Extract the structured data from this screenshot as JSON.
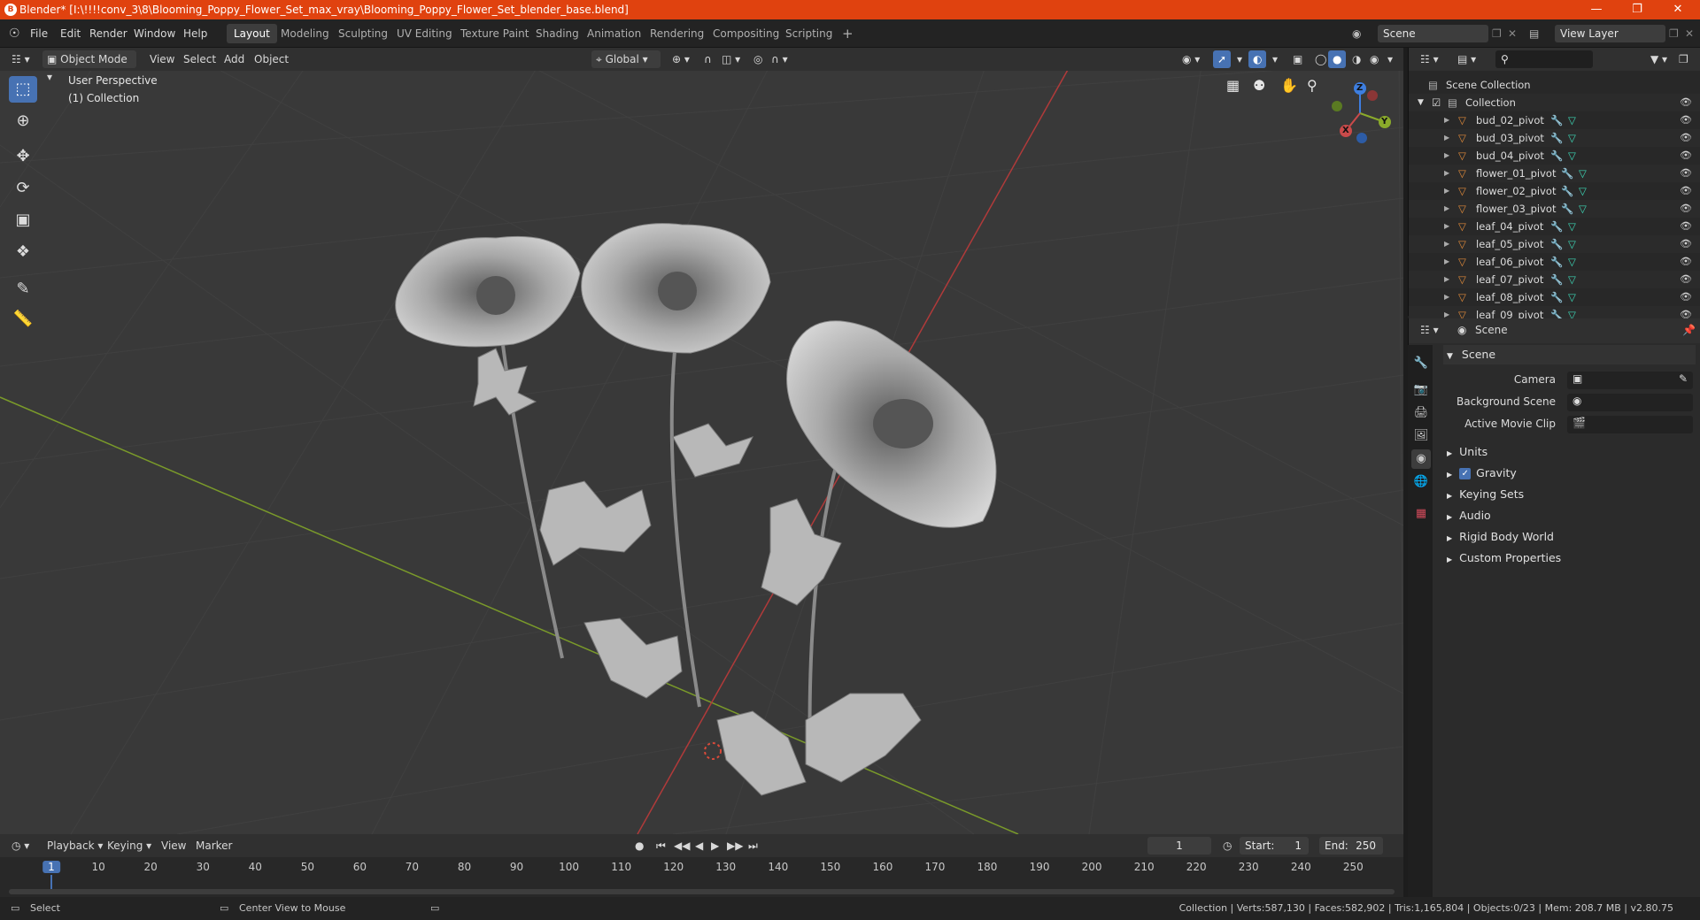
{
  "title_bar": {
    "title": "Blender* [I:\\!!!!conv_3\\8\\Blooming_Poppy_Flower_Set_max_vray\\Blooming_Poppy_Flower_Set_blender_base.blend]"
  },
  "menu": {
    "items": [
      "File",
      "Edit",
      "Render",
      "Window",
      "Help"
    ]
  },
  "workspaces": {
    "tabs": [
      "Layout",
      "Modeling",
      "Sculpting",
      "UV Editing",
      "Texture Paint",
      "Shading",
      "Animation",
      "Rendering",
      "Compositing",
      "Scripting"
    ],
    "add": "+"
  },
  "scene_selector": {
    "value": "Scene"
  },
  "view_layer_selector": {
    "value": "View Layer"
  },
  "viewport_header": {
    "mode": "Object Mode",
    "menus": [
      "View",
      "Select",
      "Add",
      "Object"
    ],
    "transform_orientation": "Global"
  },
  "viewport": {
    "perspective": "User Perspective",
    "collection": "(1) Collection"
  },
  "gizmo": {
    "x": "X",
    "y": "Y",
    "z": "Z"
  },
  "outliner": {
    "search_placeholder": "",
    "root": "Scene Collection",
    "collection": "Collection",
    "items": [
      "bud_02_pivot",
      "bud_03_pivot",
      "bud_04_pivot",
      "flower_01_pivot",
      "flower_02_pivot",
      "flower_03_pivot",
      "leaf_04_pivot",
      "leaf_05_pivot",
      "leaf_06_pivot",
      "leaf_07_pivot",
      "leaf_08_pivot",
      "leaf_09_pivot"
    ]
  },
  "properties": {
    "header": "Scene",
    "section": "Scene",
    "camera_label": "Camera",
    "background_scene_label": "Background Scene",
    "active_movie_clip_label": "Active Movie Clip",
    "panels": [
      "Units",
      "Gravity",
      "Keying Sets",
      "Audio",
      "Rigid Body World",
      "Custom Properties"
    ],
    "gravity_enabled": true
  },
  "timeline": {
    "menus": [
      "Playback",
      "Keying",
      "View",
      "Marker"
    ],
    "current_frame": "1",
    "start_label": "Start:",
    "start": "1",
    "end_label": "End:",
    "end": "250",
    "ticks": [
      "1",
      "10",
      "20",
      "30",
      "40",
      "50",
      "60",
      "70",
      "80",
      "90",
      "100",
      "110",
      "120",
      "130",
      "140",
      "150",
      "160",
      "170",
      "180",
      "190",
      "200",
      "210",
      "220",
      "230",
      "240",
      "250"
    ]
  },
  "status_bar": {
    "left_action": "Select",
    "middle_action": "Center View to Mouse",
    "stats": "Collection | Verts:587,130 | Faces:582,902 | Tris:1,165,804 | Objects:0/23 | Mem: 208.7 MB | v2.80.75"
  },
  "colors": {
    "title_bar": "#e0420f",
    "accent": "#4772b3",
    "x_axis": "#c94a4a",
    "y_axis": "#8aaa2b",
    "z_axis": "#3d7ee0"
  }
}
